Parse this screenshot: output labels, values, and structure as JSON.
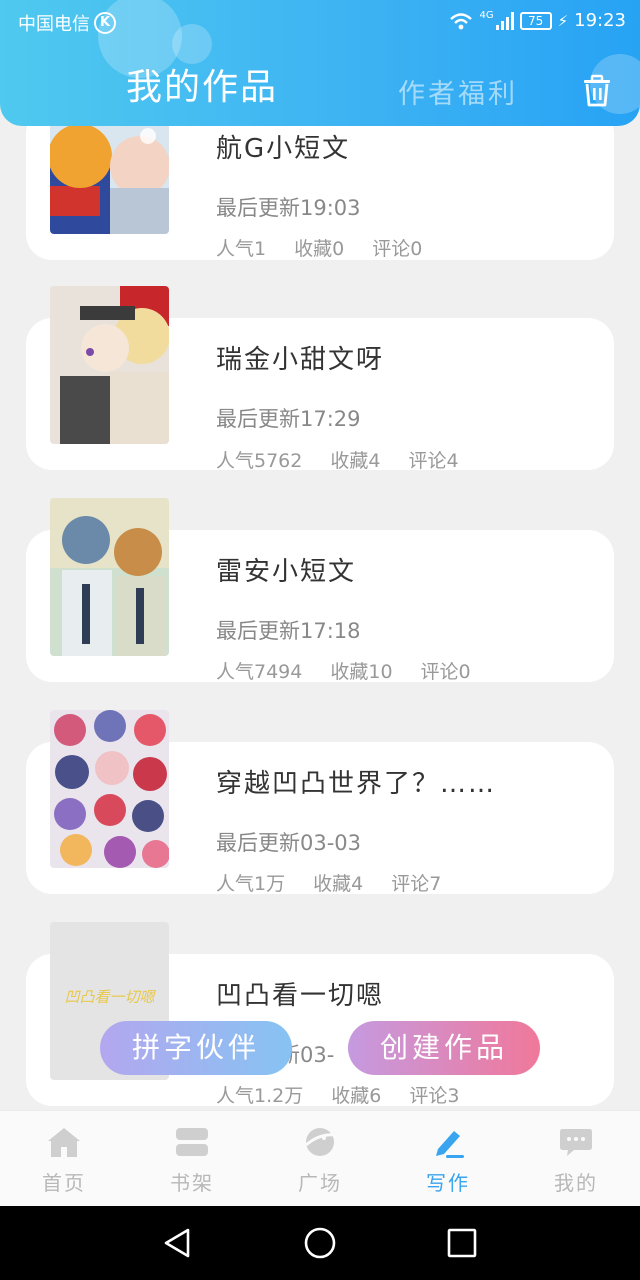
{
  "status_bar": {
    "carrier": "中国电信",
    "carrier_badge": "K",
    "network": "4G",
    "battery": "75",
    "time": "19:23"
  },
  "header": {
    "active_tab": "我的作品",
    "inactive_tab": "作者福利",
    "delete_icon": "trash-icon"
  },
  "works": [
    {
      "title": "航G小短文",
      "updated": "最后更新19:03",
      "popularity": "人气1",
      "favorites": "收藏0",
      "comments": "评论0"
    },
    {
      "title": "瑞金小甜文呀",
      "updated": "最后更新17:29",
      "popularity": "人气5762",
      "favorites": "收藏4",
      "comments": "评论4"
    },
    {
      "title": "雷安小短文",
      "updated": "最后更新17:18",
      "popularity": "人气7494",
      "favorites": "收藏10",
      "comments": "评论0"
    },
    {
      "title": "穿越凹凸世界了？……",
      "updated": "最后更新03-03",
      "popularity": "人气1万",
      "favorites": "收藏4",
      "comments": "评论7"
    },
    {
      "title": "凹凸看一切嗯",
      "updated": "最后更新03-",
      "popularity": "人气1.2万",
      "favorites": "收藏6",
      "comments": "评论3",
      "cover_text": "凹凸看一切嗯"
    }
  ],
  "actions": {
    "partner_label": "拼字伙伴",
    "create_label": "创建作品"
  },
  "bottom_nav": [
    {
      "label": "首页",
      "icon": "home-icon"
    },
    {
      "label": "书架",
      "icon": "bookshelf-icon"
    },
    {
      "label": "广场",
      "icon": "planet-icon"
    },
    {
      "label": "写作",
      "icon": "pen-icon",
      "active": true
    },
    {
      "label": "我的",
      "icon": "chat-bubble-icon"
    }
  ],
  "colors": {
    "accent": "#39a4ef",
    "header_start": "#4fc9ef",
    "header_end": "#27a3f4",
    "create_start": "#c59ae0",
    "create_end": "#f0789a",
    "partner_start": "#b3a7ef",
    "partner_end": "#86c3f3"
  }
}
